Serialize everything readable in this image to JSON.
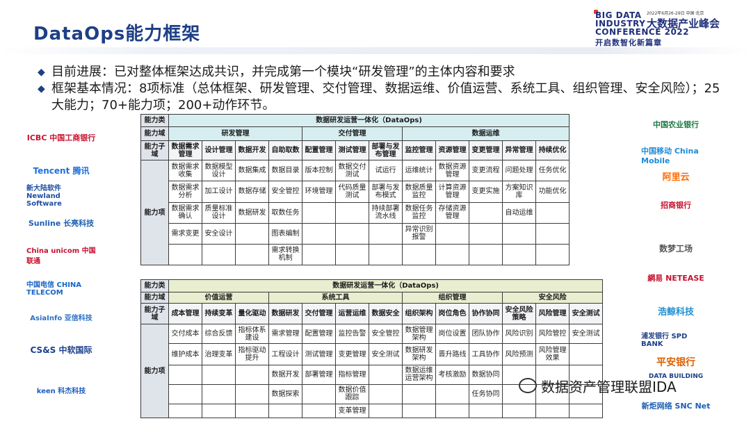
{
  "title": "DataOps能力框架",
  "conference": {
    "en_line1": "BIG DATA",
    "en_line2": "INDUSTRY",
    "en_line3": "CONFERENCE 2022",
    "date": "2022年6月26-29日 中国·北京",
    "cn_name": "大数据产业峰会",
    "slogan": "开启数智化新篇章"
  },
  "bullets": [
    "目前进展：已对整体框架达成共识，并完成第一个模块“研发管理”的主体内容和要求",
    "框架基本情况：8项标准（总体框架、研发管理、交付管理、数据运维、价值运营、系统工具、组织管理、安全风险）；25大能力；70+能力项；200+动作环节。"
  ],
  "left_logos": [
    "ICBC 中国工商银行",
    "Tencent 腾讯",
    "新大陆软件 Newland Software",
    "Sunline 长亮科技",
    "China unicom 中国联通",
    "中国电信 CHINA TELECOM",
    "AsiaInfo 亚信科技",
    "CS&S 中软国际",
    "keen 科杰科技"
  ],
  "right_logos": [
    "中国农业银行",
    "中国移动 China Mobile",
    "阿里云",
    "招商银行",
    "数梦工场",
    "網易 NETEASE",
    "浩鲸科技",
    "浦发银行 SPD BANK",
    "平安银行",
    "DATA BUILDING",
    "新炬网络 SNC Net"
  ],
  "watermark": "数据资产管理联盟IDA",
  "table1": {
    "cat_label": "能力类",
    "cat_value": "数据研发运营一体化（DataOps)",
    "domain_label": "能力域",
    "domains": [
      "研发管理",
      "交付管理",
      "数据运维"
    ],
    "sub_label": "能力子域",
    "subs": [
      "数据需求管理",
      "设计管理",
      "数据开发",
      "自助取数",
      "配置管理",
      "测试管理",
      "部署与发布管理",
      "监控管理",
      "资源管理",
      "变更管理",
      "异常管理",
      "持续优化"
    ],
    "item_label": "能力项",
    "rows": [
      [
        "数据需求收集",
        "数据模型设计",
        "数据集成",
        "数据目录",
        "版本控制",
        "数据交付测试",
        "试运行",
        "运维统计",
        "数据资源管理",
        "变更流程",
        "问题处理",
        "任务优化"
      ],
      [
        "数据需求分析",
        "加工设计",
        "数据存储",
        "安全管控",
        "环境管理",
        "代码质量测试",
        "部署与发布模式",
        "数据质量监控",
        "计算资源管理",
        "变更实施",
        "方案知识库",
        "功能优化"
      ],
      [
        "数据需求确认",
        "质量标准设计",
        "数据研发",
        "取数任务",
        "",
        "",
        "持续部署流水线",
        "数据任务监控",
        "存储资源管理",
        "",
        "自动运维",
        ""
      ],
      [
        "需求变更",
        "安全设计",
        "",
        "图表编制",
        "",
        "",
        "",
        "异常识别报警",
        "",
        "",
        "",
        ""
      ],
      [
        "",
        "",
        "",
        "需求转换机制",
        "",
        "",
        "",
        "",
        "",
        "",
        "",
        ""
      ]
    ]
  },
  "table2": {
    "cat_label": "能力类",
    "cat_value": "数据研发运营一体化（DataOps)",
    "domain_label": "能力域",
    "domains": [
      "价值运营",
      "系统工具",
      "组织管理",
      "安全风险"
    ],
    "sub_label": "能力子域",
    "subs": [
      "成本管理",
      "持续变革",
      "量化驱动",
      "数据研发",
      "交付管理",
      "运营运维",
      "数据安全",
      "组织架构",
      "岗位角色",
      "协作协同",
      "安全风险策略",
      "风险管理",
      "安全测试"
    ],
    "item_label": "能力项",
    "rows": [
      [
        "交付成本",
        "综合反馈",
        "指标体系建设",
        "需求管理",
        "配置管理",
        "监控告警",
        "安全管控",
        "数据管理架构",
        "岗位设置",
        "团队协作",
        "风险识别",
        "风险管控",
        "安全测试"
      ],
      [
        "维护成本",
        "治理变革",
        "指标驱动提升",
        "工程设计",
        "测试管理",
        "变更管理",
        "安全测试",
        "数据研发架构",
        "晋升路线",
        "工具协作",
        "风险预测",
        "风险管理效果",
        ""
      ],
      [
        "",
        "",
        "",
        "数据开发",
        "部署管理",
        "指标管理",
        "",
        "数据运维运营架构",
        "考核激励",
        "数据协同",
        "",
        "",
        ""
      ],
      [
        "",
        "",
        "",
        "数据探索",
        "",
        "数据价值跟踪",
        "",
        "",
        "",
        "任务协同",
        "",
        "",
        ""
      ],
      [
        "",
        "",
        "",
        "",
        "",
        "变革管理",
        "",
        "",
        "",
        "",
        "",
        "",
        ""
      ]
    ]
  }
}
